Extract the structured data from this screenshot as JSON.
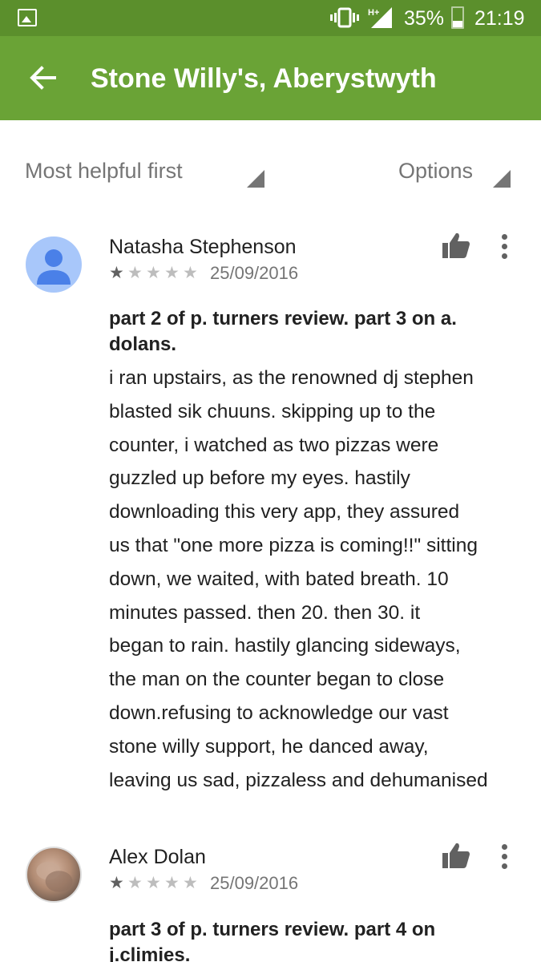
{
  "status_bar": {
    "network_label": "H+",
    "battery_percent": "35%",
    "battery_level": 0.35,
    "time": "21:19",
    "icons": [
      "gallery-icon",
      "vibrate-icon",
      "signal-icon",
      "battery-icon"
    ]
  },
  "app_bar": {
    "title": "Stone Willy's, Aberystwyth",
    "back_icon": "back-arrow-icon",
    "color": "#6aa336",
    "status_color": "#5b8f2c"
  },
  "filters": {
    "sort_label": "Most helpful first",
    "options_label": "Options"
  },
  "reviews": [
    {
      "author": "Natasha Stephenson",
      "avatar": "default-avatar",
      "rating": 1,
      "max_rating": 5,
      "date": "25/09/2016",
      "title": "part 2 of p. turners review. part 3 on a. dolans.",
      "body_lines": [
        "i ran upstairs, as the renowned dj stephen",
        "blasted sik chuuns. skipping up to the",
        "counter, i watched as two pizzas were",
        "guzzled up before my eyes. hastily",
        "downloading this very app, they assured",
        "us that \"one more pizza is coming!!\" sitting",
        "down, we waited, with bated breath. 10",
        "minutes passed. then 20. then 30. it",
        "began to rain. hastily glancing sideways,",
        "the man on the counter began to close",
        "down.refusing to acknowledge our vast",
        "stone willy support, he danced away,",
        "leaving us sad, pizzaless and dehumanised"
      ]
    },
    {
      "author": "Alex Dolan",
      "avatar": "photo-avatar",
      "rating": 1,
      "max_rating": 5,
      "date": "25/09/2016",
      "title": "part 3 of p. turners review. part 4 on j.climies."
    }
  ]
}
